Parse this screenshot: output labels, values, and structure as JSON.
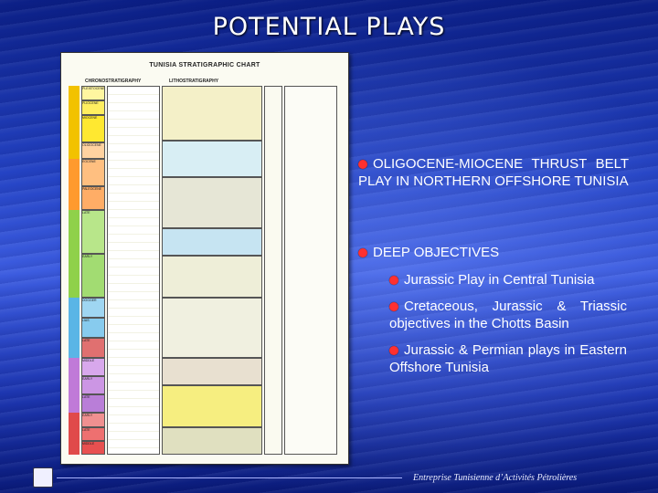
{
  "slide": {
    "title": "POTENTIAL PLAYS",
    "chart_image": {
      "title": "TUNISIA STRATIGRAPHIC CHART",
      "col_chrono": "CHRONOSTRATIGRAPHY",
      "col_litho": "LITHOSTRATIGRAPHY",
      "col_ages": [
        "PLEISTOCENE",
        "PLIOCENE",
        "MIOCENE",
        "OLIGOCENE",
        "EOCENE",
        "PALEOCENE"
      ],
      "col_ages_lower": [
        "LATE",
        "EARLY",
        "DOGGER",
        "LIAS",
        "LATE",
        "MIDDLE",
        "EARLY",
        "LATE",
        "EARLY",
        "LATE",
        "MIDDLE",
        "EARLY",
        "LATE",
        "MIDDLE",
        "EARLY"
      ]
    },
    "bullets": {
      "b1": "OLIGOCENE-MIOCENE THRUST BELT PLAY IN NORTHERN OFFSHORE TUNISIA",
      "b2": "DEEP OBJECTIVES",
      "s1": "Jurassic Play in Central Tunisia",
      "s2": "Cretaceous, Jurassic & Triassic objectives in the Chotts Basin",
      "s3": "Jurassic & Permian plays in Eastern Offshore Tunisia"
    },
    "footer": "Entreprise Tunisienne d’Activités Pétrolières",
    "colors": {
      "background": "#2443c4",
      "bullet": "#ff3030",
      "text": "#ffffff"
    }
  }
}
